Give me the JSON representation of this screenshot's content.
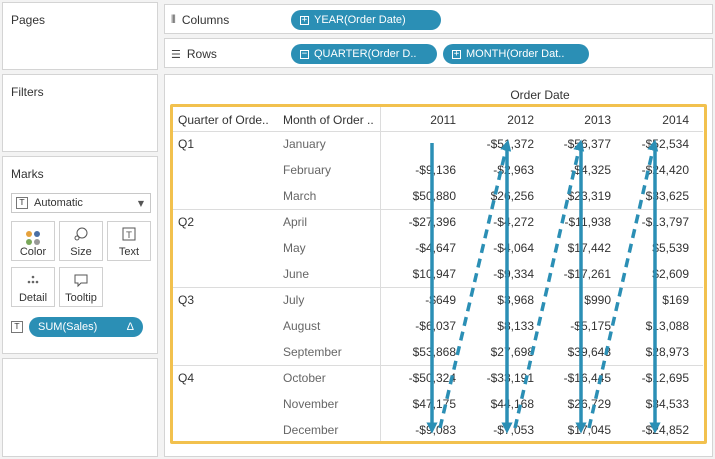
{
  "left_panels": {
    "pages_title": "Pages",
    "filters_title": "Filters",
    "marks_title": "Marks"
  },
  "marks": {
    "mark_type": "Automatic",
    "buttons": [
      {
        "label": "Color",
        "icon": "color-dots-icon"
      },
      {
        "label": "Size",
        "icon": "size-icon"
      },
      {
        "label": "Text",
        "icon": "text-icon"
      },
      {
        "label": "Detail",
        "icon": "detail-icon"
      },
      {
        "label": "Tooltip",
        "icon": "tooltip-icon"
      }
    ],
    "field_pill": "SUM(Sales)",
    "field_pill_delta": "Δ"
  },
  "shelves": {
    "columns_label": "Columns",
    "rows_label": "Rows",
    "columns_pills": [
      "YEAR(Order Date)"
    ],
    "rows_pills": [
      "QUARTER(Order D..",
      "MONTH(Order Dat.."
    ]
  },
  "view": {
    "column_group_title": "Order Date",
    "row_header_1": "Quarter of Orde..",
    "row_header_2": "Month of Order ..",
    "years": [
      "2011",
      "2012",
      "2013",
      "2014"
    ],
    "quarters": [
      "Q1",
      "Q2",
      "Q3",
      "Q4"
    ],
    "months": [
      "January",
      "February",
      "March",
      "April",
      "May",
      "June",
      "July",
      "August",
      "September",
      "October",
      "November",
      "December"
    ],
    "cells": [
      [
        "",
        "-$51,372",
        "-$56,377",
        "-$52,534"
      ],
      [
        "-$9,136",
        "-$2,963",
        "-$4,325",
        "-$24,420"
      ],
      [
        "$50,880",
        "$26,256",
        "$23,319",
        "$33,625"
      ],
      [
        "-$27,396",
        "-$4,272",
        "-$11,938",
        "-$13,797"
      ],
      [
        "-$4,647",
        "-$4,064",
        "$17,442",
        "$5,539"
      ],
      [
        "$10,947",
        "-$9,334",
        "-$17,261",
        "$2,609"
      ],
      [
        "-$649",
        "$3,968",
        "$990",
        "$169"
      ],
      [
        "-$6,037",
        "$8,133",
        "-$5,175",
        "$13,088"
      ],
      [
        "$53,868",
        "$27,698",
        "$39,643",
        "$28,973"
      ],
      [
        "-$50,324",
        "-$33,191",
        "-$16,445",
        "-$12,695"
      ],
      [
        "$47,175",
        "$44,168",
        "$26,729",
        "$34,533"
      ],
      [
        "-$9,083",
        "-$7,053",
        "$17,045",
        "-$24,852"
      ]
    ]
  },
  "colors": {
    "pill_blue": "#2b8fb5",
    "highlight_yellow": "#f2c14e",
    "arrow_blue": "#2b8fb5"
  }
}
